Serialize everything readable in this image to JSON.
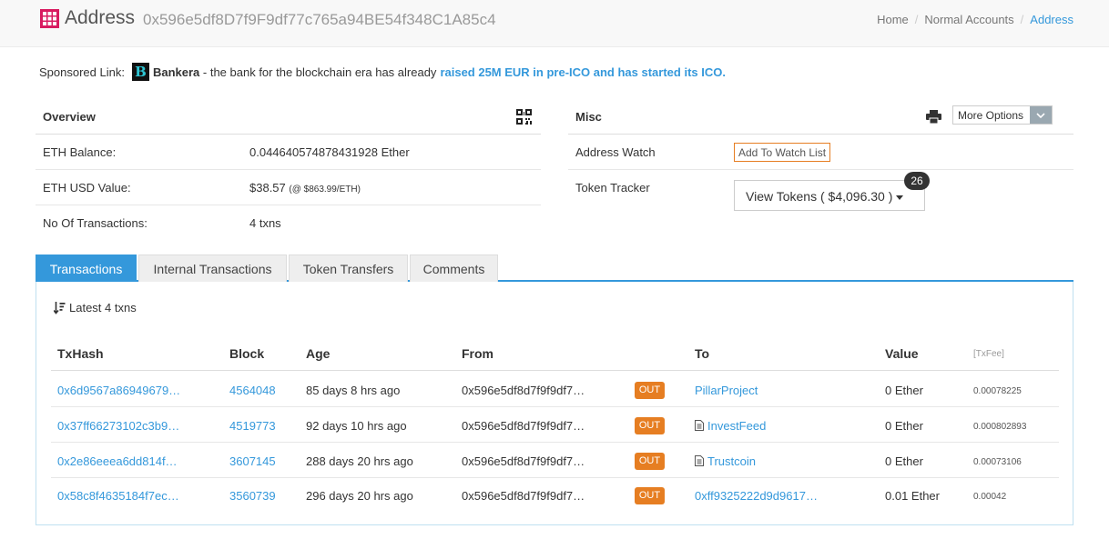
{
  "header": {
    "title": "Address",
    "address": "0x596e5df8D7f9F9df77c765a94BE54f348C1A85c4",
    "breadcrumb": [
      "Home",
      "Normal Accounts",
      "Address"
    ]
  },
  "sponsor": {
    "label": "Sponsored Link:",
    "logo_letter": "B",
    "brand": "Bankera",
    "text": "- the bank for the blockchain era has already",
    "highlight": "raised 25M EUR in pre-ICO and has started its ICO."
  },
  "overview": {
    "title": "Overview",
    "rows": [
      {
        "label": "ETH Balance:",
        "value": "0.044640574878431928 Ether",
        "note": ""
      },
      {
        "label": "ETH USD Value:",
        "value": "$38.57",
        "note": "(@ $863.99/ETH)"
      },
      {
        "label": "No Of Transactions:",
        "value": "4 txns",
        "note": ""
      }
    ]
  },
  "misc": {
    "title": "Misc",
    "more_options": "More Options",
    "address_watch_label": "Address Watch",
    "watch_button": "Add To Watch List",
    "token_tracker_label": "Token Tracker",
    "view_tokens": "View Tokens ( $4,096.30 )",
    "token_count": "26"
  },
  "tabs": [
    "Transactions",
    "Internal Transactions",
    "Token Transfers",
    "Comments"
  ],
  "transactions": {
    "summary": "Latest 4 txns",
    "columns": [
      "TxHash",
      "Block",
      "Age",
      "From",
      "To",
      "Value",
      "[TxFee]"
    ],
    "rows": [
      {
        "hash": "0x6d9567a86949679…",
        "block": "4564048",
        "age": "85 days 8 hrs ago",
        "from": "0x596e5df8d7f9f9df7…",
        "dir": "OUT",
        "to": "PillarProject",
        "to_contract": false,
        "value": "0 Ether",
        "fee": "0.00078225"
      },
      {
        "hash": "0x37ff66273102c3b9…",
        "block": "4519773",
        "age": "92 days 10 hrs ago",
        "from": "0x596e5df8d7f9f9df7…",
        "dir": "OUT",
        "to": "InvestFeed",
        "to_contract": true,
        "value": "0 Ether",
        "fee": "0.000802893"
      },
      {
        "hash": "0x2e86eeea6dd814f…",
        "block": "3607145",
        "age": "288 days 20 hrs ago",
        "from": "0x596e5df8d7f9f9df7…",
        "dir": "OUT",
        "to": "Trustcoin",
        "to_contract": true,
        "value": "0 Ether",
        "fee": "0.00073106"
      },
      {
        "hash": "0x58c8f4635184f7ec…",
        "block": "3560739",
        "age": "296 days 20 hrs ago",
        "from": "0x596e5df8d7f9f9df7…",
        "dir": "OUT",
        "to": "0xff9325222d9d9617…",
        "to_contract": false,
        "value": "0.01 Ether",
        "fee": "0.00042"
      }
    ]
  },
  "colors": {
    "accent": "#3498db",
    "out_badge": "#e67e22",
    "logo": "#d81b60"
  }
}
